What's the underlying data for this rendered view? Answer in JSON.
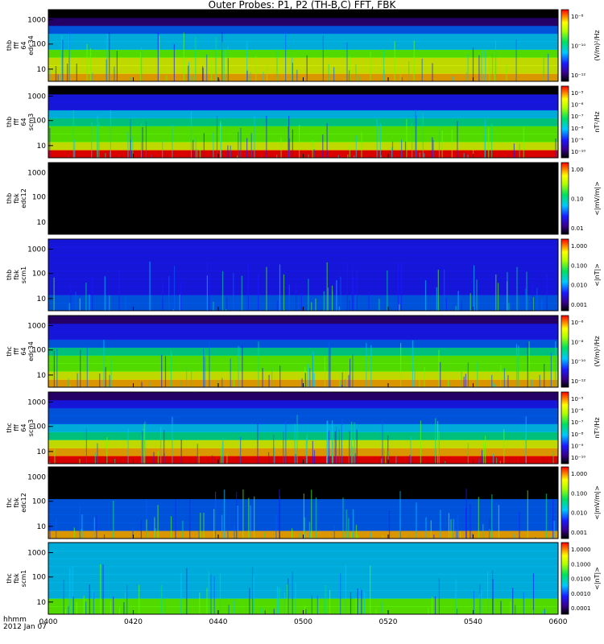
{
  "title": "Outer Probes: P1, P2 (TH-B,C) FFT, FBK",
  "footer": {
    "time_label": "hhmm",
    "date_label": "2012 Jan 07"
  },
  "x_ticks": [
    "0400",
    "0420",
    "0440",
    "0500",
    "0520",
    "0540",
    "0600"
  ],
  "colors": {
    "panel_bg": "#000000",
    "spec_low": "#1a1aff",
    "spec_high": "#ff0000"
  },
  "chart_data": [
    {
      "type": "heatmap",
      "ylabel": [
        "thb",
        "fff",
        "64",
        "edc34"
      ],
      "y_ticks": [
        "1000",
        "100",
        "10"
      ],
      "y_scale": "log",
      "zlabel": "(V/m)²/Hz",
      "z_ticks": [
        "10⁻⁸",
        "10⁻¹⁰",
        "10⁻¹²"
      ]
    },
    {
      "type": "heatmap",
      "ylabel": [
        "thb",
        "fff",
        "64",
        "scm3"
      ],
      "y_ticks": [
        "1000",
        "100",
        "10"
      ],
      "y_scale": "log",
      "zlabel": "nT²/Hz",
      "z_ticks": [
        "10⁻⁵",
        "10⁻⁶",
        "10⁻⁷",
        "10⁻⁸",
        "10⁻⁹",
        "10⁻¹⁰"
      ]
    },
    {
      "type": "heatmap",
      "ylabel": [
        "thb",
        "fbk",
        "edc12"
      ],
      "y_ticks": [
        "1000",
        "100",
        "10"
      ],
      "y_scale": "log",
      "zlabel": "<|mV/m|>",
      "z_ticks": [
        "1.00",
        "0.10",
        "0.01"
      ]
    },
    {
      "type": "heatmap",
      "ylabel": [
        "thb",
        "fbk",
        "scm1"
      ],
      "y_ticks": [
        "1000",
        "100",
        "10"
      ],
      "y_scale": "log",
      "zlabel": "<|nT|>",
      "z_ticks": [
        "1.000",
        "0.100",
        "0.010",
        "0.001"
      ]
    },
    {
      "type": "heatmap",
      "ylabel": [
        "thc",
        "fff",
        "64",
        "edc34"
      ],
      "y_ticks": [
        "1000",
        "100",
        "10"
      ],
      "y_scale": "log",
      "zlabel": "(V/m)²/Hz",
      "z_ticks": [
        "10⁻⁶",
        "10⁻⁸",
        "10⁻¹⁰",
        "10⁻¹²"
      ]
    },
    {
      "type": "heatmap",
      "ylabel": [
        "thc",
        "fff",
        "64",
        "scm3"
      ],
      "y_ticks": [
        "1000",
        "100",
        "10"
      ],
      "y_scale": "log",
      "zlabel": "nT²/Hz",
      "z_ticks": [
        "10⁻⁵",
        "10⁻⁶",
        "10⁻⁷",
        "10⁻⁸",
        "10⁻⁹",
        "10⁻¹⁰"
      ]
    },
    {
      "type": "heatmap",
      "ylabel": [
        "thc",
        "fbk",
        "edc12"
      ],
      "y_ticks": [
        "1000",
        "100",
        "10"
      ],
      "y_scale": "log",
      "zlabel": "<|mV/m|>",
      "z_ticks": [
        "1.000",
        "0.100",
        "0.010",
        "0.001"
      ]
    },
    {
      "type": "heatmap",
      "ylabel": [
        "thc",
        "fbk",
        "scm1"
      ],
      "y_ticks": [
        "1000",
        "100",
        "10"
      ],
      "y_scale": "log",
      "zlabel": "<|nT|>",
      "z_ticks": [
        "1.0000",
        "0.1000",
        "0.0100",
        "0.0010",
        "0.0001"
      ]
    }
  ]
}
